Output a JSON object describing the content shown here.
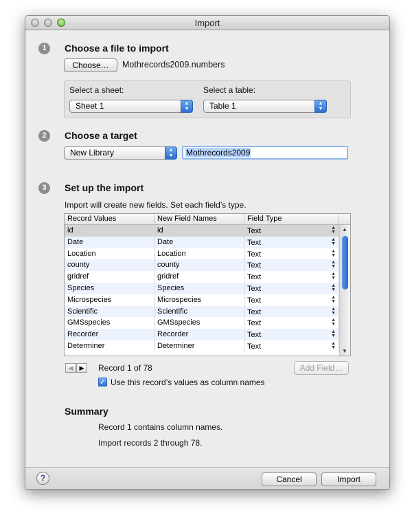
{
  "window": {
    "title": "Import"
  },
  "step1": {
    "number": "1",
    "heading": "Choose a file to import",
    "choose_button": "Choose…",
    "file_name": "Mothrecords2009.numbers",
    "sheet_label": "Select a sheet:",
    "sheet_value": "Sheet 1",
    "table_label": "Select a table:",
    "table_value": "Table 1"
  },
  "step2": {
    "number": "2",
    "heading": "Choose a target",
    "target_value": "New Library",
    "library_name": "Mothrecords2009"
  },
  "step3": {
    "number": "3",
    "heading": "Set up the import",
    "description": "Import will create new fields. Set each field’s type.",
    "columns": [
      "Record Values",
      "New Field Names",
      "Field Type"
    ],
    "rows": [
      {
        "value": "id",
        "name": "id",
        "type": "Text"
      },
      {
        "value": "Date",
        "name": "Date",
        "type": "Text"
      },
      {
        "value": "Location",
        "name": "Location",
        "type": "Text"
      },
      {
        "value": "county",
        "name": "county",
        "type": "Text"
      },
      {
        "value": "gridref",
        "name": "gridref",
        "type": "Text"
      },
      {
        "value": "Species",
        "name": "Species",
        "type": "Text"
      },
      {
        "value": "Microspecies",
        "name": "Microspecies",
        "type": "Text"
      },
      {
        "value": "Scientific",
        "name": "Scientific",
        "type": "Text"
      },
      {
        "value": "GMSspecies",
        "name": "GMSspecies",
        "type": "Text"
      },
      {
        "value": "Recorder",
        "name": "Recorder",
        "type": "Text"
      },
      {
        "value": "Determiner",
        "name": "Determiner",
        "type": "Text"
      }
    ],
    "record_status": "Record 1 of 78",
    "add_field_button": "Add Field…",
    "use_names_label": "Use this record’s values as column names",
    "use_names_checked": true
  },
  "summary": {
    "heading": "Summary",
    "line1": "Record 1 contains column names.",
    "line2": "Import records 2 through 78."
  },
  "footer": {
    "help_symbol": "?",
    "cancel_label": "Cancel",
    "import_label": "Import"
  },
  "icons": {
    "prev": "◀",
    "next": "▶",
    "popup_up": "▲",
    "popup_down": "▼",
    "check": "✓"
  }
}
